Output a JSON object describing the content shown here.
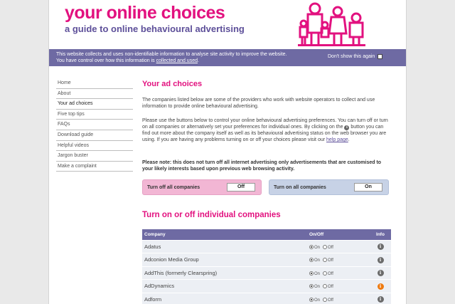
{
  "header": {
    "title": "your online choices",
    "subtitle": "a guide to online behavioural advertising"
  },
  "cookie_bar": {
    "line1": "This website collects and uses non-identifiable information to analyse site activity to improve the website.",
    "line2_prefix": "You have control over how this information is ",
    "line2_link": "collected and used",
    "line2_suffix": ".",
    "dismiss_label": "Don't show this again",
    "dismiss_checked": false
  },
  "sidebar": {
    "items": [
      {
        "label": "Home"
      },
      {
        "label": "About"
      },
      {
        "label": "Your ad choices"
      },
      {
        "label": "Five top tips"
      },
      {
        "label": "FAQs"
      },
      {
        "label": "Download guide"
      },
      {
        "label": "Helpful videos"
      },
      {
        "label": "Jargon buster"
      },
      {
        "label": "Make a complaint"
      }
    ]
  },
  "main": {
    "title": "Your ad choices",
    "intro": "The companies listed below are some of the providers who work with website operators to collect and use information to provide online behavioural advertising.",
    "instructions_part1": "Please use the buttons below to control your online behavioural advertising preferences. You can turn off or turn on all companies or alternatively set your preferences for individual ones. By clicking on the",
    "instructions_part2": "button you can find out more about the company itself as well as its behavioural advertising status on the web browser you are using. If you are having any problems turning on or off your choices please visit our",
    "help_link": "help page",
    "instructions_end": ".",
    "note": "Please note: this does not turn off all internet advertising only advertisements that are customised to your likely interests based upon previous web browsing activity.",
    "turn_off_all": {
      "label": "Turn off all companies",
      "button": "Off"
    },
    "turn_on_all": {
      "label": "Turn on all companies",
      "button": "On"
    },
    "companies_title": "Turn on or off individual companies",
    "table": {
      "headers": {
        "company": "Company",
        "onoff": "On/Off",
        "info": "Info"
      },
      "on_label": "On",
      "off_label": "Off",
      "rows": [
        {
          "company": "Adatus",
          "state": "On",
          "info_color": "#6b6b6b"
        },
        {
          "company": "Adconion Media Group",
          "state": "On",
          "info_color": "#6b6b6b"
        },
        {
          "company": "AddThis (formerly Clearspring)",
          "state": "On",
          "info_color": "#6b6b6b"
        },
        {
          "company": "AdDynamics",
          "state": "On",
          "info_color": "#ee7a10"
        },
        {
          "company": "Adform",
          "state": "On",
          "info_color": "#6b6b6b"
        }
      ]
    }
  },
  "colors": {
    "brand_pink": "#e2117f",
    "brand_purple": "#5d4f99",
    "bar_purple": "#6e6aa3"
  }
}
